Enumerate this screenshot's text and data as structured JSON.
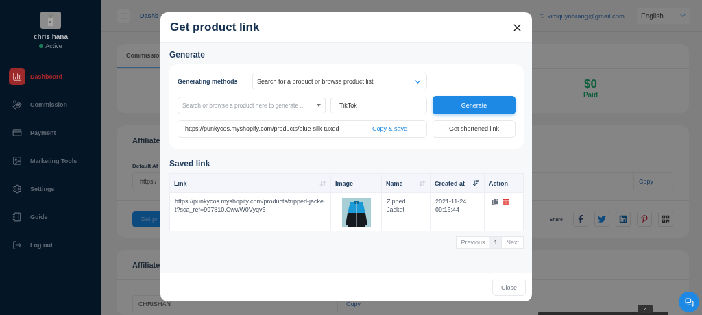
{
  "sidebar": {
    "user_name": "chris hana",
    "status": "Active",
    "items": [
      {
        "label": "Dashboard",
        "selected": true
      },
      {
        "label": "Commission",
        "selected": false
      },
      {
        "label": "Payment",
        "selected": false
      },
      {
        "label": "Marketing Tools",
        "selected": false
      },
      {
        "label": "Settings",
        "selected": false
      },
      {
        "label": "Guide",
        "selected": false
      },
      {
        "label": "Log out",
        "selected": false
      }
    ]
  },
  "topbar": {
    "breadcrumb": "Dashb",
    "contact_label": "rt:",
    "email": "kimquynhrang@gmail.com",
    "language": "English"
  },
  "background": {
    "summary_card": {
      "tab": "Commissio",
      "amount": "$0",
      "amount_label": "Paid"
    },
    "link_card": {
      "title": "Affiliate",
      "field_label": "Default Af",
      "field_value": "https:/",
      "copy_button": "Copy",
      "primary_button": "Get pr",
      "share_label": "Share"
    },
    "coupon_card": {
      "title": "Affiliate",
      "field_value": "CHRISHAN",
      "copy_button": "Copy"
    }
  },
  "modal": {
    "title": "Get product link",
    "generate": {
      "title": "Generate",
      "method_label": "Generating methods",
      "method_value": "Search for a product or browse product list",
      "product_placeholder": "Search or browse a product here to generate ...",
      "source_value": "TikTok",
      "generate_button": "Generate",
      "url_value": "https://punkycos.myshopify.com/products/blue-silk-tuxed",
      "copy_button": "Copy & save",
      "shorten_button": "Get shortened link"
    },
    "saved": {
      "title": "Saved link",
      "columns": [
        {
          "label": "Link",
          "sortable": true,
          "sorted": false
        },
        {
          "label": "Image",
          "sortable": false,
          "sorted": false
        },
        {
          "label": "Name",
          "sortable": true,
          "sorted": false
        },
        {
          "label": "Created at",
          "sortable": true,
          "sorted": true
        },
        {
          "label": "Action",
          "sortable": false,
          "sorted": false
        }
      ],
      "rows": [
        {
          "link": "https://punkycos.myshopify.com/products/zipped-jacket?sca_ref=997810.CwwW0Vyqv6",
          "name": "Zipped Jacket",
          "created_at": "2021-11-24 09:16:44"
        }
      ],
      "pagination": [
        {
          "label": "Previous",
          "selected": false
        },
        {
          "label": "1",
          "selected": true
        },
        {
          "label": "Next",
          "selected": false
        }
      ]
    },
    "close_button": "Close"
  }
}
